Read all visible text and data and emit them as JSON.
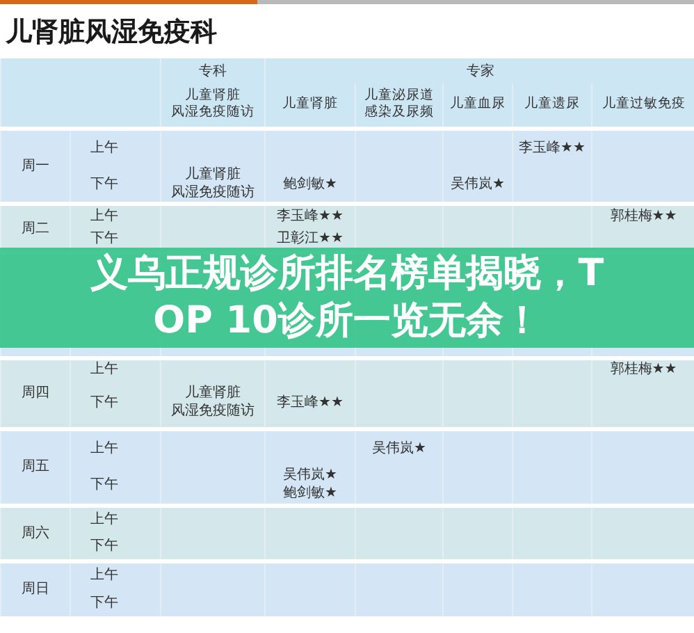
{
  "title": "儿肾脏风湿免疫科",
  "groups": [
    {
      "label": "专科",
      "columns": [
        {
          "lines": [
            "儿童肾脏",
            "风湿免疫随访"
          ]
        }
      ]
    },
    {
      "label": "专家",
      "columns": [
        {
          "lines": [
            "儿童肾脏"
          ]
        },
        {
          "lines": [
            "儿童泌尿道",
            "感染及尿频"
          ]
        },
        {
          "lines": [
            "儿童血尿"
          ]
        },
        {
          "lines": [
            "儿童遗尿"
          ]
        },
        {
          "lines": [
            "儿童过敏免疫"
          ]
        }
      ]
    }
  ],
  "days": [
    {
      "day": "周一",
      "sessions": [
        {
          "period": "上午",
          "cells": [
            null,
            null,
            null,
            null,
            [
              "李玉峰★★"
            ],
            null
          ]
        },
        {
          "period": "下午",
          "cells": [
            {
              "lines": [
                "儿童肾脏",
                "风湿免疫随访"
              ]
            },
            [
              "鲍剑敏★"
            ],
            null,
            [
              "吴伟岚★"
            ],
            null,
            null
          ]
        }
      ]
    },
    {
      "day": "周二",
      "sessions": [
        {
          "period": "上午",
          "cells": [
            null,
            [
              "李玉峰★★"
            ],
            null,
            null,
            null,
            [
              "郭桂梅★★"
            ]
          ]
        },
        {
          "period": "下午",
          "cells": [
            null,
            [
              "卫彰江★★"
            ],
            null,
            null,
            null,
            null
          ]
        }
      ]
    },
    {
      "sessions": [
        {
          "cells": [
            null,
            null,
            null,
            null,
            null,
            null
          ]
        },
        {
          "cells": [
            null,
            null,
            null,
            null,
            null,
            null
          ]
        }
      ]
    },
    {
      "day": "周四",
      "sessions": [
        {
          "period": "上午",
          "cells": [
            null,
            null,
            null,
            null,
            null,
            [
              "郭桂梅★★"
            ]
          ]
        },
        {
          "period": "下午",
          "cells": [
            {
              "lines": [
                "儿童肾脏",
                "风湿免疫随访"
              ]
            },
            [
              "李玉峰★★"
            ],
            null,
            null,
            null,
            null
          ]
        }
      ]
    },
    {
      "day": "周五",
      "sessions": [
        {
          "period": "上午",
          "cells": [
            null,
            null,
            [
              "吴伟岚★"
            ],
            null,
            null,
            null
          ]
        },
        {
          "period": "下午",
          "cells": [
            null,
            [
              "吴伟岚★",
              "鲍剑敏★"
            ],
            null,
            null,
            null,
            null
          ]
        }
      ]
    },
    {
      "day": "周六",
      "sessions": [
        {
          "period": "上午",
          "cells": [
            null,
            null,
            null,
            null,
            null,
            null
          ]
        },
        {
          "period": "下午",
          "cells": [
            null,
            null,
            null,
            null,
            null,
            null
          ]
        }
      ]
    },
    {
      "day": "周日",
      "sessions": [
        {
          "period": "上午",
          "cells": [
            null,
            null,
            null,
            null,
            null,
            null
          ]
        },
        {
          "period": "下午",
          "cells": [
            null,
            null,
            null,
            null,
            null,
            null
          ]
        }
      ]
    }
  ],
  "banner": {
    "text": "义乌正规诊所排名榜单揭晓，TOP 10诊所一览无余！"
  }
}
